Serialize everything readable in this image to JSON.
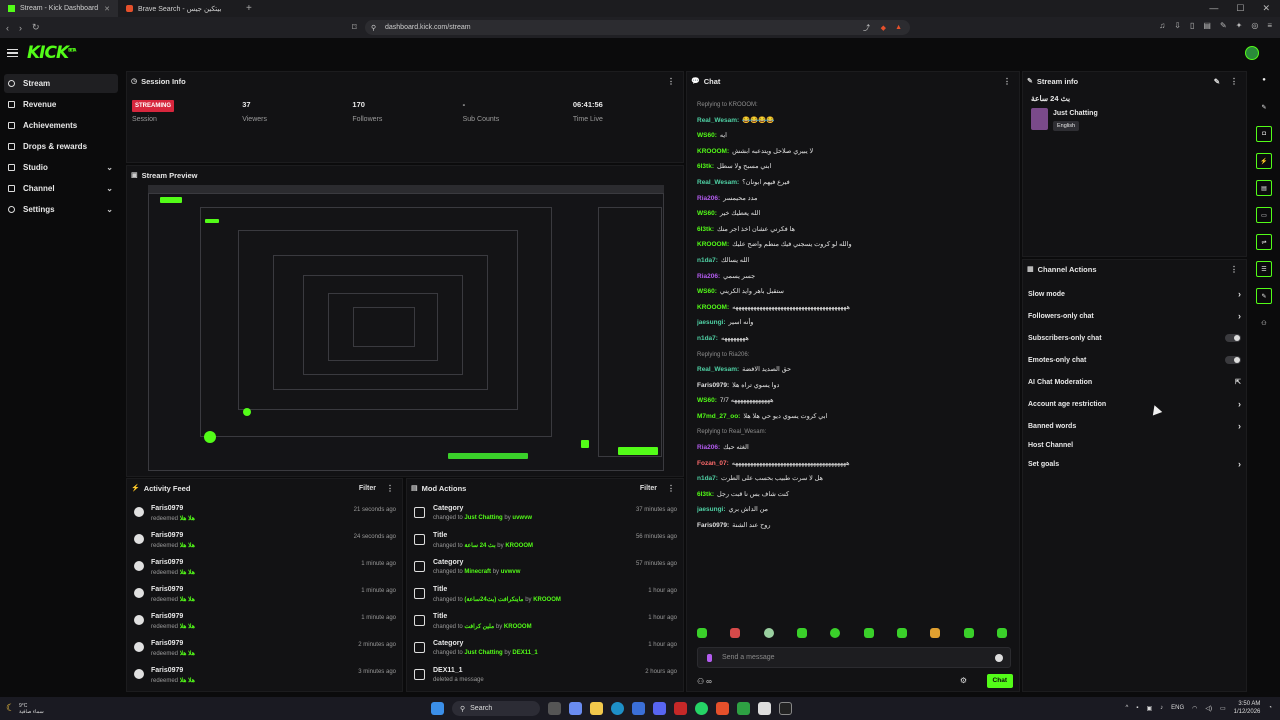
{
  "browser": {
    "tabs": [
      {
        "title": "Stream - Kick Dashboard",
        "active": true
      },
      {
        "title": "Brave Search - بيتكين جيس",
        "active": false
      }
    ],
    "new_tab": "+",
    "url": "dashboard.kick.com/stream"
  },
  "app": {
    "logo": "KICK",
    "logo_badge": "BETA"
  },
  "sidebar": {
    "items": [
      {
        "label": "Stream",
        "active": true,
        "has_chevron": false
      },
      {
        "label": "Revenue",
        "has_chevron": false
      },
      {
        "label": "Achievements",
        "has_chevron": false
      },
      {
        "label": "Drops & rewards",
        "has_chevron": false
      },
      {
        "label": "Studio",
        "has_chevron": true
      },
      {
        "label": "Channel",
        "has_chevron": true
      },
      {
        "label": "Settings",
        "has_chevron": true
      }
    ]
  },
  "session_info": {
    "title": "Session Info",
    "status_badge": "STREAMING",
    "stats": [
      {
        "value": "",
        "label": "Session"
      },
      {
        "value": "37",
        "label": "Viewers"
      },
      {
        "value": "170",
        "label": "Followers"
      },
      {
        "value": "-",
        "label": "Sub Counts"
      },
      {
        "value": "06:41:56",
        "label": "Time Live"
      }
    ]
  },
  "stream_preview": {
    "title": "Stream Preview"
  },
  "activity_feed": {
    "title": "Activity Feed",
    "filter_label": "Filter",
    "items": [
      {
        "name": "Faris0979",
        "action": "redeemed",
        "reward": "هلا هلا",
        "time": "21 seconds ago"
      },
      {
        "name": "Faris0979",
        "action": "redeemed",
        "reward": "هلا هلا",
        "time": "24 seconds ago"
      },
      {
        "name": "Faris0979",
        "action": "redeemed",
        "reward": "هلا هلا",
        "time": "1 minute ago"
      },
      {
        "name": "Faris0979",
        "action": "redeemed",
        "reward": "هلا هلا",
        "time": "1 minute ago"
      },
      {
        "name": "Faris0979",
        "action": "redeemed",
        "reward": "هلا هلا",
        "time": "1 minute ago"
      },
      {
        "name": "Faris0979",
        "action": "redeemed",
        "reward": "هلا هلا",
        "time": "2 minutes ago"
      },
      {
        "name": "Faris0979",
        "action": "redeemed",
        "reward": "هلا هلا",
        "time": "3 minutes ago"
      }
    ]
  },
  "mod_actions": {
    "title": "Mod Actions",
    "filter_label": "Filter",
    "items": [
      {
        "title": "Category",
        "prefix": "changed to",
        "value": "Just Chatting",
        "by": "by",
        "user": "uvwvw",
        "time": "37 minutes ago"
      },
      {
        "title": "Title",
        "prefix": "changed to",
        "value": "بث 24 ساعة",
        "by": "by",
        "user": "KROOOM",
        "time": "56 minutes ago"
      },
      {
        "title": "Category",
        "prefix": "changed to",
        "value": "Minecraft",
        "by": "by",
        "user": "uvwvw",
        "time": "57 minutes ago"
      },
      {
        "title": "Title",
        "prefix": "changed to",
        "value": "ماينكرافت (بث24ساعة)",
        "by": "by",
        "user": "KROOOM",
        "time": "1 hour ago"
      },
      {
        "title": "Title",
        "prefix": "changed to",
        "value": "ملين كرافت",
        "by": "by",
        "user": "KROOOM",
        "time": "1 hour ago"
      },
      {
        "title": "Category",
        "prefix": "changed to",
        "value": "Just Chatting",
        "by": "by",
        "user": "DEX11_1",
        "time": "1 hour ago"
      },
      {
        "title": "DEX11_1",
        "prefix": "deleted a message",
        "value": "",
        "by": "",
        "user": "",
        "time": "2 hours ago"
      }
    ]
  },
  "chat": {
    "title": "Chat",
    "messages": [
      {
        "reply": "Replying to KROOOM:",
        "user": "",
        "text": "",
        "color": "#8d8d8d"
      },
      {
        "reply": "",
        "user": "Real_Wesam:",
        "text": "😂😂😂😂",
        "color": "#4fd1a5"
      },
      {
        "reply": "",
        "user": "WS60:",
        "text": "ايه",
        "color": "#53fc18"
      },
      {
        "reply": "",
        "user": "KROOOM:",
        "text": "لا يبيري صلاحل ويتدعبه ابشش",
        "color": "#53fc18"
      },
      {
        "reply": "",
        "user": "6l3tk:",
        "text": "ابني مسبح ولا سطل",
        "color": "#53fc18"
      },
      {
        "reply": "",
        "user": "Real_Wesam:",
        "text": "فيرع فيهم ابونان؟",
        "color": "#4fd1a5"
      },
      {
        "reply": "",
        "user": "Ria206:",
        "text": "مدد محيمسر",
        "color": "#b45cf0"
      },
      {
        "reply": "",
        "user": "WS60:",
        "text": "الله يعطيك خير",
        "color": "#53fc18"
      },
      {
        "reply": "",
        "user": "6l3tk:",
        "text": "ها فكرني عشان اخذ اجر منك",
        "color": "#53fc18"
      },
      {
        "reply": "",
        "user": "KROOOM:",
        "text": "والله لو كروت يسجني فيك منطم واضح عليك",
        "color": "#53fc18"
      },
      {
        "reply": "",
        "user": "n1da7:",
        "text": "الله يسالك",
        "color": "#4fd1a5"
      },
      {
        "reply": "",
        "user": "Ria206:",
        "text": "جسر يسمي",
        "color": "#b45cf0"
      },
      {
        "reply": "",
        "user": "WS60:",
        "text": "ستقبل باهر وايد الكريني",
        "color": "#53fc18"
      },
      {
        "reply": "",
        "user": "KROOOM:",
        "text": "ههههههههههههههههههههههههههههههههههههههه",
        "color": "#53fc18"
      },
      {
        "reply": "",
        "user": "jaesungi:",
        "text": "وأنه اسير",
        "color": "#4fd1a5"
      },
      {
        "reply": "",
        "user": "n1da7:",
        "text": "ههههههههه",
        "color": "#4fd1a5"
      },
      {
        "reply": "Replying to Ria206:",
        "user": "",
        "text": "",
        "color": "#8d8d8d"
      },
      {
        "reply": "",
        "user": "Real_Wesam:",
        "text": "حق الصديد الافضة",
        "color": "#4fd1a5"
      },
      {
        "reply": "",
        "user": "Faris0979:",
        "text": "دوا يسوي تراه هلا",
        "color": "#e0e0e0"
      },
      {
        "reply": "",
        "user": "WS60:",
        "text": "هههههههههههههه 7/7",
        "color": "#53fc18"
      },
      {
        "reply": "",
        "user": "M7md_27_oo:",
        "text": "ابي كروت يسوي ديو حي هلا هلا",
        "color": "#53fc18"
      },
      {
        "reply": "Replying to Real_Wesam:",
        "user": "",
        "text": "",
        "color": "#8d8d8d"
      },
      {
        "reply": "",
        "user": "Ria206:",
        "text": "الغثه حبك",
        "color": "#b45cf0"
      },
      {
        "reply": "",
        "user": "Fozan_07:",
        "text": "ههههههههههههههههههههههههههههههههههههههه",
        "color": "#ff6b6b"
      },
      {
        "reply": "",
        "user": "n1da7:",
        "text": "هل لا سرت طبيب بحسب على الطرت",
        "color": "#4fd1a5"
      },
      {
        "reply": "",
        "user": "6l3tk:",
        "text": "كنت شاف بس نا قبت رجل",
        "color": "#53fc18"
      },
      {
        "reply": "",
        "user": "jaesungi:",
        "text": "من الداش بري",
        "color": "#4fd1a5"
      },
      {
        "reply": "",
        "user": "Faris0979:",
        "text": "روح عند الشنة",
        "color": "#e0e0e0"
      }
    ],
    "input_placeholder": "Send a message",
    "send_label": "Chat",
    "points_label": "∞"
  },
  "stream_info": {
    "title": "Stream info",
    "stream_title": "بث 24 ساعة",
    "category": "Just Chatting",
    "language": "English"
  },
  "channel_actions": {
    "title": "Channel Actions",
    "items": [
      {
        "label": "Slow mode",
        "control": "chevron"
      },
      {
        "label": "Followers-only chat",
        "control": "chevron"
      },
      {
        "label": "Subscribers-only chat",
        "control": "toggle"
      },
      {
        "label": "Emotes-only chat",
        "control": "toggle"
      },
      {
        "label": "AI Chat Moderation",
        "control": "external"
      },
      {
        "label": "Account age restriction",
        "control": "chevron"
      },
      {
        "label": "Banned words",
        "control": "chevron"
      },
      {
        "label": "Host Channel",
        "control": "none"
      },
      {
        "label": "Set goals",
        "control": "chevron"
      }
    ]
  },
  "taskbar": {
    "temp": "9°C",
    "weather": "سماء صافية",
    "search": "Search",
    "lang": "ENG",
    "time": "3:50 AM",
    "date": "1/12/2026"
  },
  "colors": {
    "accent": "#53fc18",
    "live": "#d7263d"
  }
}
